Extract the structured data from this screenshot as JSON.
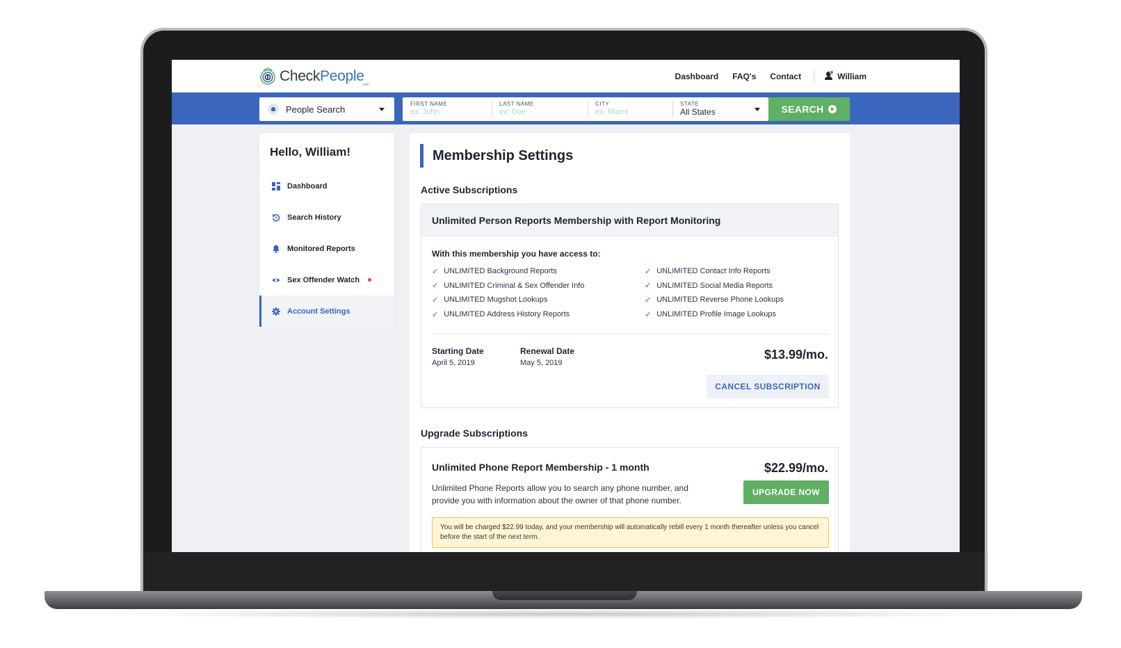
{
  "brand": {
    "name_dark": "Check",
    "name_blue": "People",
    "name_sub": ".com"
  },
  "topnav": {
    "items": [
      "Dashboard",
      "FAQ's",
      "Contact"
    ],
    "user_name": "William"
  },
  "search": {
    "type_label": "People Search",
    "first_name": {
      "label": "FIRST NAME",
      "placeholder": "ex: John"
    },
    "last_name": {
      "label": "LAST NAME",
      "placeholder": "ex: Doe"
    },
    "city": {
      "label": "CITY",
      "placeholder": "ex: Miami"
    },
    "state": {
      "label": "STATE",
      "value": "All States"
    },
    "button": "SEARCH"
  },
  "sidebar": {
    "greeting": "Hello, William!",
    "items": [
      {
        "label": "Dashboard",
        "icon": "dashboard-icon"
      },
      {
        "label": "Search History",
        "icon": "history-icon"
      },
      {
        "label": "Monitored Reports",
        "icon": "bell-icon"
      },
      {
        "label": "Sex Offender Watch",
        "icon": "eye-icon"
      },
      {
        "label": "Account Settings",
        "icon": "gear-icon"
      }
    ],
    "active_index": 4
  },
  "main": {
    "title": "Membership Settings",
    "active_heading": "Active Subscriptions",
    "subscription": {
      "name": "Unlimited Person Reports Membership with Report Monitoring",
      "access_title": "With this membership you have access to:",
      "features_left": [
        "UNLIMITED Background Reports",
        "UNLIMITED Criminal & Sex Offender Info",
        "UNLIMITED Mugshot Lookups",
        "UNLIMITED Address History Reports"
      ],
      "features_right": [
        "UNLIMITED Contact Info Reports",
        "UNLIMITED Social Media Reports",
        "UNLIMITED Reverse Phone Lookups",
        "UNLIMITED Profile Image Lookups"
      ],
      "start_label": "Starting Date",
      "start_value": "April 5, 2019",
      "renew_label": "Renewal Date",
      "renew_value": "May 5, 2019",
      "price": "$13.99/mo.",
      "cancel_label": "CANCEL SUBSCRIPTION"
    },
    "upgrade_heading": "Upgrade Subscriptions",
    "upgrade": {
      "name": "Unlimited Phone Report Membership - 1 month",
      "price": "$22.99/mo.",
      "description": "Unlimited Phone Reports allow you to search any phone number, and provide you with information about the owner of that phone number.",
      "button": "UPGRADE NOW",
      "notice": "You will be charged $22.99 today, and your membership will automatically rebill every 1 month thereafter unless you cancel before the start of the next term."
    }
  },
  "colors": {
    "accent": "#3b66bd",
    "success": "#5faf64",
    "alert": "#e0424f"
  }
}
